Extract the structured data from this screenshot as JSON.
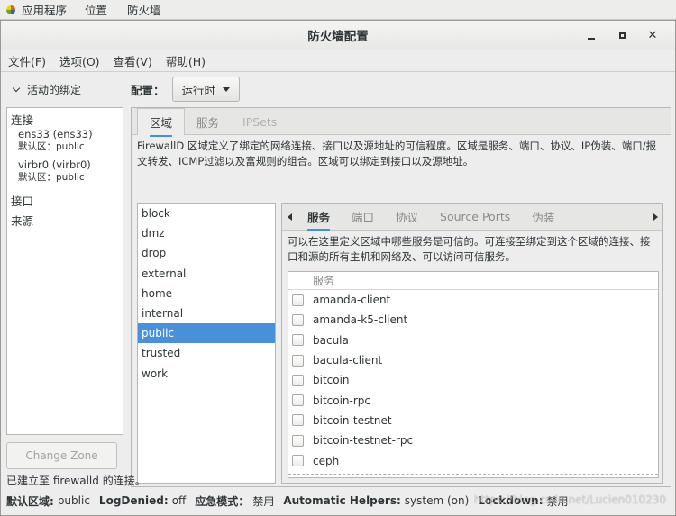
{
  "topbar": {
    "items": [
      "应用程序",
      "位置",
      "防火墙"
    ]
  },
  "window": {
    "title": "防火墙配置"
  },
  "menubar": {
    "items": [
      "文件(F)",
      "选项(O)",
      "查看(V)",
      "帮助(H)"
    ]
  },
  "left": {
    "header": "活动的绑定",
    "sections": {
      "connections": "连接",
      "interfaces": "接口",
      "sources": "来源"
    },
    "bindings": [
      {
        "name": "ens33 (ens33)",
        "zone": "默认区：public"
      },
      {
        "name": "virbr0 (virbr0)",
        "zone": "默认区：public"
      }
    ],
    "change_zone_label": "Change Zone"
  },
  "config": {
    "label": "配置：",
    "value": "运行时"
  },
  "main_tabs": [
    "区域",
    "服务",
    "IPSets"
  ],
  "zone_description": "FirewallD 区域定义了绑定的网络连接、接口以及源地址的可信程度。区域是服务、端口、协议、IP伪装、端口/报文转发、ICMP过滤以及富规则的组合。区域可以绑定到接口以及源地址。",
  "zones": [
    "block",
    "dmz",
    "drop",
    "external",
    "home",
    "internal",
    "public",
    "trusted",
    "work"
  ],
  "selected_zone": "public",
  "sub_tabs": [
    "服务",
    "端口",
    "协议",
    "Source Ports",
    "伪装"
  ],
  "service_description": "可以在这里定义区域中哪些服务是可信的。可连接至绑定到这个区域的连接、接口和源的所有主机和网络及、可以访问可信服务。",
  "services_header": "服务",
  "services": [
    "amanda-client",
    "amanda-k5-client",
    "bacula",
    "bacula-client",
    "bitcoin",
    "bitcoin-rpc",
    "bitcoin-testnet",
    "bitcoin-testnet-rpc",
    "ceph"
  ],
  "status": {
    "connection": "已建立至  firewalld 的连接。",
    "default_zone_key": "默认区域:",
    "default_zone_val": "public",
    "log_denied_key": "LogDenied:",
    "log_denied_val": "off",
    "panic_key": "应急模式：",
    "panic_val": "禁用",
    "helpers_key": "Automatic Helpers:",
    "helpers_val": "system (on)",
    "lockdown_key": "Lockdown:",
    "lockdown_val": "禁用"
  },
  "watermark": "https://blog.csdn.net/Lucien010230",
  "colors": {
    "selection": "#4a90d9",
    "tab_accent": "#4a90d9"
  }
}
